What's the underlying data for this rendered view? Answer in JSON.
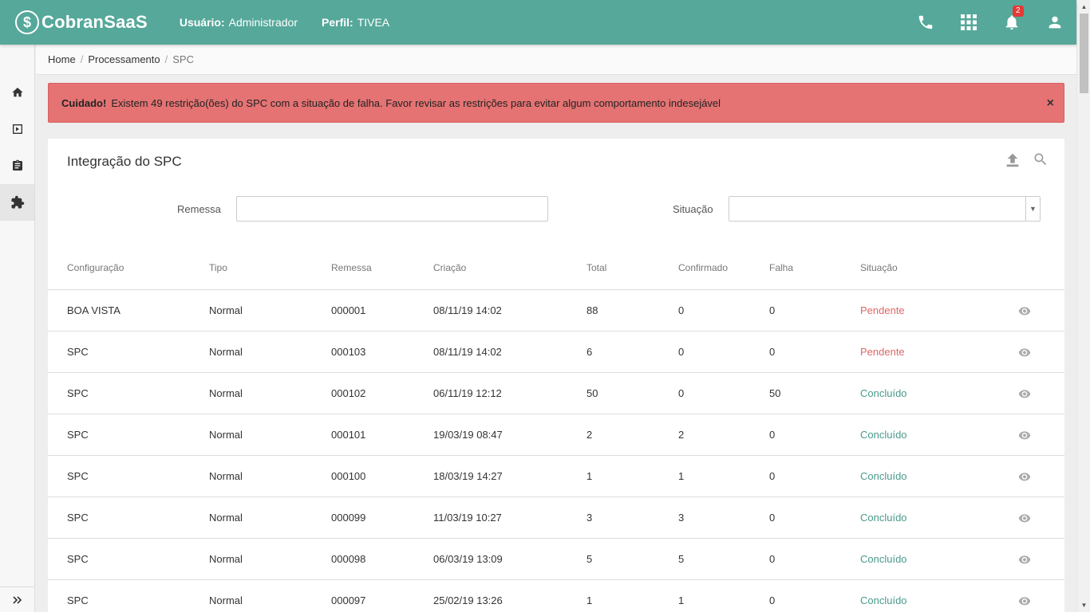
{
  "header": {
    "brand": "CobranSaaS",
    "user_label": "Usuário:",
    "user_value": "Administrador",
    "profile_label": "Perfil:",
    "profile_value": "TIVEA",
    "notification_count": "2",
    "icons": [
      "phone-icon",
      "apps-grid-icon",
      "bell-icon",
      "user-icon"
    ],
    "color": "#55a89a"
  },
  "sidebar": {
    "items": [
      "home-icon",
      "play-icon",
      "clipboard-icon",
      "puzzle-icon"
    ],
    "active": "puzzle-icon",
    "expand_icon": "double-chevron-right-icon"
  },
  "breadcrumb": {
    "items": [
      "Home",
      "Processamento"
    ],
    "current": "SPC"
  },
  "alert": {
    "strong": "Cuidado!",
    "message": "Existem 49 restrição(ões) do SPC com a situação de falha. Favor revisar as restrições para evitar algum comportamento indesejável",
    "close": "×",
    "color": "#e57373"
  },
  "card": {
    "title": "Integração do SPC",
    "filters": {
      "remessa_label": "Remessa",
      "remessa_value": "",
      "situacao_label": "Situação",
      "situacao_value": ""
    },
    "columns": [
      "Configuração",
      "Tipo",
      "Remessa",
      "Criação",
      "Total",
      "Confirmado",
      "Falha",
      "Situação"
    ],
    "rows": [
      {
        "config": "BOA VISTA",
        "tipo": "Normal",
        "remessa": "000001",
        "criacao": "08/11/19 14:02",
        "total": "88",
        "confirmado": "0",
        "falha": "0",
        "situacao": "Pendente"
      },
      {
        "config": "SPC",
        "tipo": "Normal",
        "remessa": "000103",
        "criacao": "08/11/19 14:02",
        "total": "6",
        "confirmado": "0",
        "falha": "0",
        "situacao": "Pendente"
      },
      {
        "config": "SPC",
        "tipo": "Normal",
        "remessa": "000102",
        "criacao": "06/11/19 12:12",
        "total": "50",
        "confirmado": "0",
        "falha": "50",
        "situacao": "Concluído"
      },
      {
        "config": "SPC",
        "tipo": "Normal",
        "remessa": "000101",
        "criacao": "19/03/19 08:47",
        "total": "2",
        "confirmado": "2",
        "falha": "0",
        "situacao": "Concluído"
      },
      {
        "config": "SPC",
        "tipo": "Normal",
        "remessa": "000100",
        "criacao": "18/03/19 14:27",
        "total": "1",
        "confirmado": "1",
        "falha": "0",
        "situacao": "Concluído"
      },
      {
        "config": "SPC",
        "tipo": "Normal",
        "remessa": "000099",
        "criacao": "11/03/19 10:27",
        "total": "3",
        "confirmado": "3",
        "falha": "0",
        "situacao": "Concluído"
      },
      {
        "config": "SPC",
        "tipo": "Normal",
        "remessa": "000098",
        "criacao": "06/03/19 13:09",
        "total": "5",
        "confirmado": "5",
        "falha": "0",
        "situacao": "Concluído"
      },
      {
        "config": "SPC",
        "tipo": "Normal",
        "remessa": "000097",
        "criacao": "25/02/19 13:26",
        "total": "1",
        "confirmado": "1",
        "falha": "0",
        "situacao": "Concluído"
      }
    ],
    "status_colors": {
      "Pendente": "#e06666",
      "Concluído": "#4a9a8c"
    }
  }
}
